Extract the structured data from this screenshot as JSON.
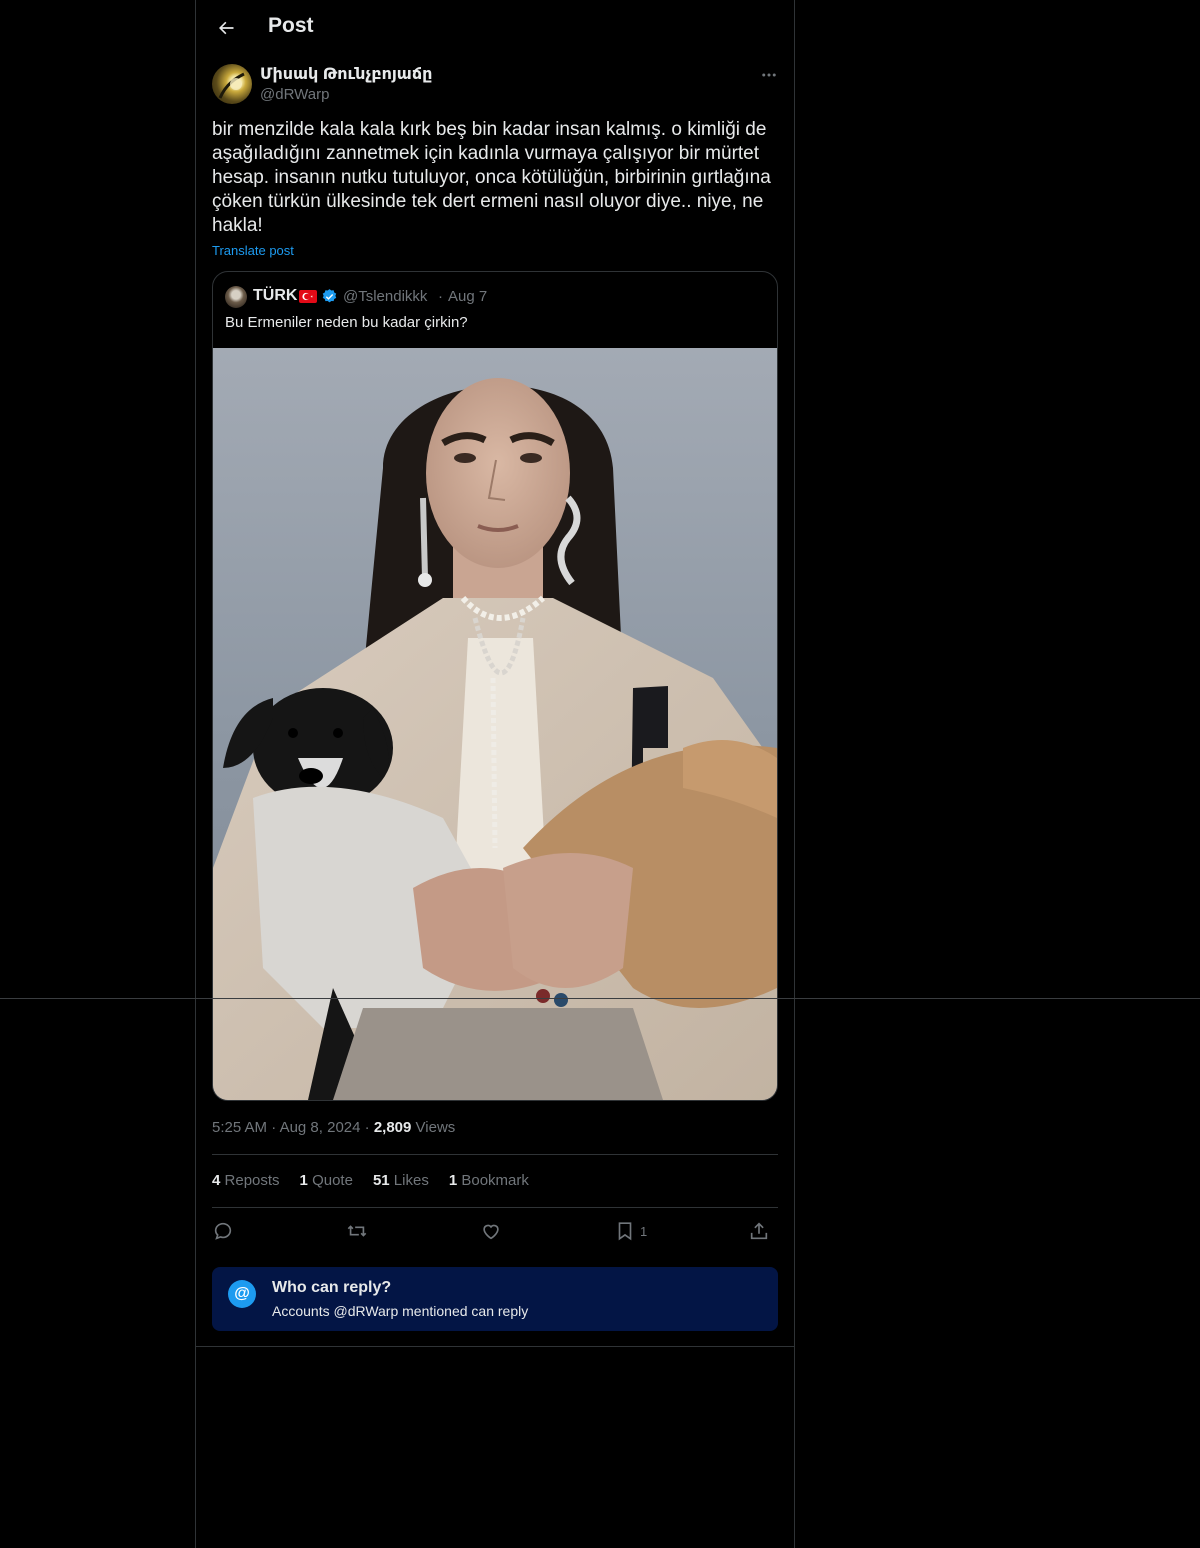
{
  "header": {
    "title": "Post"
  },
  "author": {
    "display_name": "Միսակ Թունչբոյաճը",
    "handle": "@dRWarp"
  },
  "post": {
    "text": "bir menzilde kala kala kırk beş bin kadar insan kalmış. o kimliği de aşağıladığını zannetmek için kadınla vurmaya çalışıyor bir mürtet hesap. insanın nutku tutuluyor, onca kötülüğün, birbirinin gırtlağına çöken türkün ülkesinde tek dert ermeni nasıl oluyor diye.. niye, ne hakla!",
    "translate_label": "Translate post",
    "time": "5:25 AM",
    "date": "Aug 8, 2024",
    "views_count": "2,809",
    "views_label": "Views"
  },
  "quote": {
    "name": "TÜRK",
    "handle": "@Tslendikkk",
    "date": "Aug 7",
    "text": "Bu Ermeniler neden bu kadar çirkin?"
  },
  "stats": {
    "reposts_count": "4",
    "reposts_label": "Reposts",
    "quotes_count": "1",
    "quotes_label": "Quote",
    "likes_count": "51",
    "likes_label": "Likes",
    "bookmarks_count": "1",
    "bookmarks_label": "Bookmark"
  },
  "actions": {
    "bookmark_count": "1"
  },
  "reply_restriction": {
    "title": "Who can reply?",
    "subtitle": "Accounts @dRWarp mentioned can reply"
  },
  "colors": {
    "background": "#000000",
    "accent": "#1d9bf0",
    "muted": "#71767b",
    "text": "#e7e9ea",
    "reply_box": "#031545"
  },
  "icons": [
    "back-arrow-icon",
    "more-icon",
    "verified-icon",
    "flag-icon",
    "reply-icon",
    "repost-icon",
    "like-icon",
    "bookmark-icon",
    "share-icon",
    "at-icon"
  ]
}
